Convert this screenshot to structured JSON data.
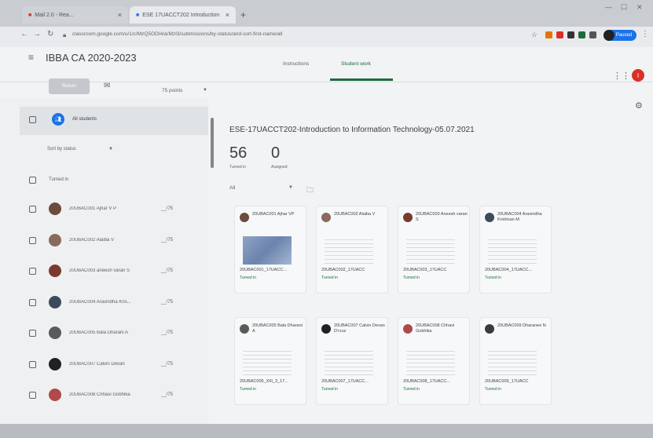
{
  "browser": {
    "tabs": [
      {
        "label": "Mail 2.0 - Rea..."
      },
      {
        "label": "ESE 17UACCT202 Introduction"
      }
    ],
    "new_tab": "+",
    "url": "classroom.google.com/u/1/c/MzQ5ODI4/a/MzI3/submissions/by-status/and-sort-first-name/all",
    "profile_label": "Paused"
  },
  "header": {
    "class_title": "IBBA CA 2020-2023",
    "tabs": [
      {
        "label": "Instructions"
      },
      {
        "label": "Student work"
      }
    ],
    "avatar_letter": "I"
  },
  "toolbar": {
    "return_label": "Return",
    "points": "75 points"
  },
  "left_panel": {
    "all_students": "All students",
    "sort_by": "Sort by status",
    "group_label": "Turned in",
    "students": [
      {
        "name": "20UBAC001 Ajhar V P",
        "grade": "__/75",
        "color": "#6b4b3b"
      },
      {
        "name": "20UBAC002 Alaiba V",
        "grade": "__/75",
        "color": "#8a6a5a"
      },
      {
        "name": "20UBAC003 aneesh varan S",
        "grade": "__/75",
        "color": "#7a3b2e"
      },
      {
        "name": "20UBAC004 Aravindha Kris...",
        "grade": "__/75",
        "color": "#3c4a5c"
      },
      {
        "name": "20UBAC005 Bala Dharani A",
        "grade": "__/75",
        "color": "#5a5a5a"
      },
      {
        "name": "20UBAC007 Calvin Devan",
        "grade": "__/75",
        "color": "#202124"
      },
      {
        "name": "20UBAC008 Chhavi Gobhika",
        "grade": "__/75",
        "color": "#b04a4a"
      }
    ]
  },
  "main": {
    "title": "ESE-17UACCT202-Introduction to Information Technology-05.07.2021",
    "turned_in_count": "56",
    "turned_in_label": "Turned in",
    "assigned_count": "0",
    "assigned_label": "Assigned",
    "filter": "All",
    "cards": [
      {
        "name": "20UBAC001 Ajhar VP",
        "file": "20UBAC001_17UACC...",
        "status": "Turned in",
        "color": "#6b4b3b"
      },
      {
        "name": "20UBAC002 Alaiba V",
        "file": "20UBAC002_17UACC",
        "status": "Turned in",
        "color": "#8a6a5a"
      },
      {
        "name": "20UBAC003 Aneesh varan S",
        "file": "20UBAC003_17UACC",
        "status": "Turned in",
        "color": "#7a3b2e"
      },
      {
        "name": "20UBAC004 Aravindha Krishnan M",
        "file": "20UBAC004_17UACC...",
        "status": "Turned in",
        "color": "#3c4a5c"
      },
      {
        "name": "20UBAC005 Bala Dharani A",
        "file": "20UBAC005_XIII_3_17...",
        "status": "Turned in",
        "color": "#5a5a5a"
      },
      {
        "name": "20UBAC007 Calvin Devan D'cruz",
        "file": "20UBAC007_17UACC...",
        "status": "Turned in",
        "color": "#202124"
      },
      {
        "name": "20UBAC008 Chhavi Gobhika",
        "file": "20UBAC008_17UACC...",
        "status": "Turned in",
        "color": "#b04a4a"
      },
      {
        "name": "20UBAC009 Dharanee N",
        "file": "20UBAC009_17UACC",
        "status": "Turned in",
        "color": "#3a3a3a"
      }
    ]
  },
  "colors": {
    "accent_green": "#1e6b3b",
    "avatar_red": "#d93025",
    "link_blue": "#1a73e8"
  }
}
